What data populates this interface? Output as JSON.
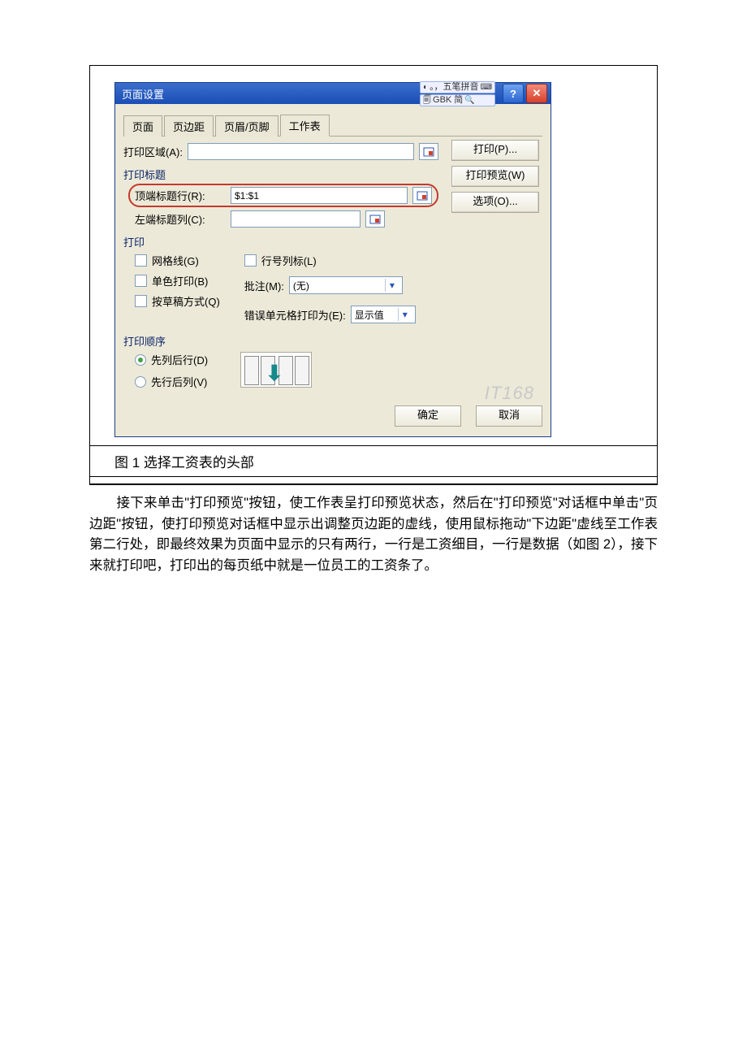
{
  "dialog": {
    "title": "页面设置",
    "ime_top": "。，五笔拼音",
    "ime_bottom": "GBK 简",
    "help_icon": "?",
    "close_icon": "✕",
    "tabs": [
      "页面",
      "页边距",
      "页眉/页脚",
      "工作表"
    ],
    "active_tab": 3,
    "print_area_label": "打印区域(A):",
    "print_area_value": "",
    "group_titles": "打印标题",
    "top_title_row_label": "顶端标题行(R):",
    "top_title_row_value": "$1:$1",
    "left_title_col_label": "左端标题列(C):",
    "left_title_col_value": "",
    "print_group": "打印",
    "chk_grid": "网格线(G)",
    "chk_mono": "单色打印(B)",
    "chk_draft": "按草稿方式(Q)",
    "chk_rowcol": "行号列标(L)",
    "comments_label": "批注(M):",
    "comments_value": "(无)",
    "errors_label": "错误单元格打印为(E):",
    "errors_value": "显示值",
    "order_group": "打印顺序",
    "radio_col_first": "先列后行(D)",
    "radio_row_first": "先行后列(V)",
    "side_print": "打印(P)...",
    "side_preview": "打印预览(W)",
    "side_options": "选项(O)...",
    "ok": "确定",
    "cancel": "取消",
    "watermark": "IT168"
  },
  "caption": "图 1 选择工资表的头部",
  "paragraph": "　　接下来单击\"打印预览\"按钮，使工作表呈打印预览状态，然后在\"打印预览\"对话框中单击\"页边距\"按钮，使打印预览对话框中显示出调整页边距的虚线，使用鼠标拖动\"下边距\"虚线至工作表第二行处，即最终效果为页面中显示的只有两行，一行是工资细目，一行是数据（如图 2），接下来就打印吧，打印出的每页纸中就是一位员工的工资条了。"
}
